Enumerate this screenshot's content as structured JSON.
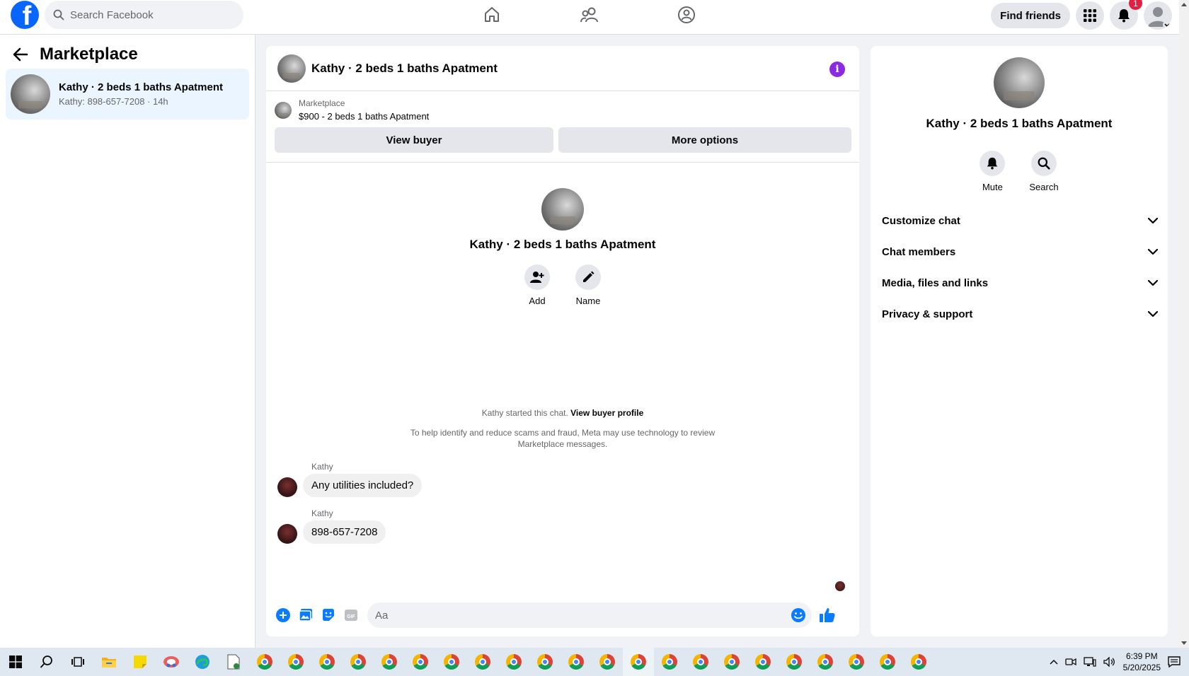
{
  "topbar": {
    "search_placeholder": "Search Facebook",
    "find_friends_label": "Find friends",
    "notification_count": "1"
  },
  "sidebar": {
    "title": "Marketplace",
    "conversation": {
      "title": "Kathy · 2 beds 1 baths Apatment",
      "subtitle": "Kathy: 898-657-7208 · 14h"
    }
  },
  "chat": {
    "header_title": "Kathy · 2 beds 1 baths Apatment",
    "listing_label": "Marketplace",
    "listing_price_title": "$900 - 2 beds 1 baths Apatment",
    "view_buyer_label": "View buyer",
    "more_options_label": "More options",
    "profile_name": "Kathy · 2 beds 1 baths Apatment",
    "add_label": "Add",
    "name_label": "Name",
    "started_text": "Kathy started this chat.",
    "view_buyer_profile_label": "View buyer profile",
    "scam_notice": "To help identify and reduce scams and fraud, Meta may use technology to review Marketplace messages.",
    "messages": [
      {
        "sender": "Kathy",
        "text": "Any utilities included?"
      },
      {
        "sender": "Kathy",
        "text": "898-657-7208"
      }
    ],
    "input_placeholder": "Aa"
  },
  "right_panel": {
    "name": "Kathy · 2 beds 1 baths Apatment",
    "mute_label": "Mute",
    "search_label": "Search",
    "sections": [
      "Customize chat",
      "Chat members",
      "Media, files and links",
      "Privacy & support"
    ]
  },
  "taskbar": {
    "time": "6:39 PM",
    "date": "5/20/2025"
  },
  "colors": {
    "facebook_blue": "#0866ff",
    "messenger_blue": "#0a7cff",
    "info_purple": "#8a2be2",
    "badge_red": "#e41e3f"
  }
}
